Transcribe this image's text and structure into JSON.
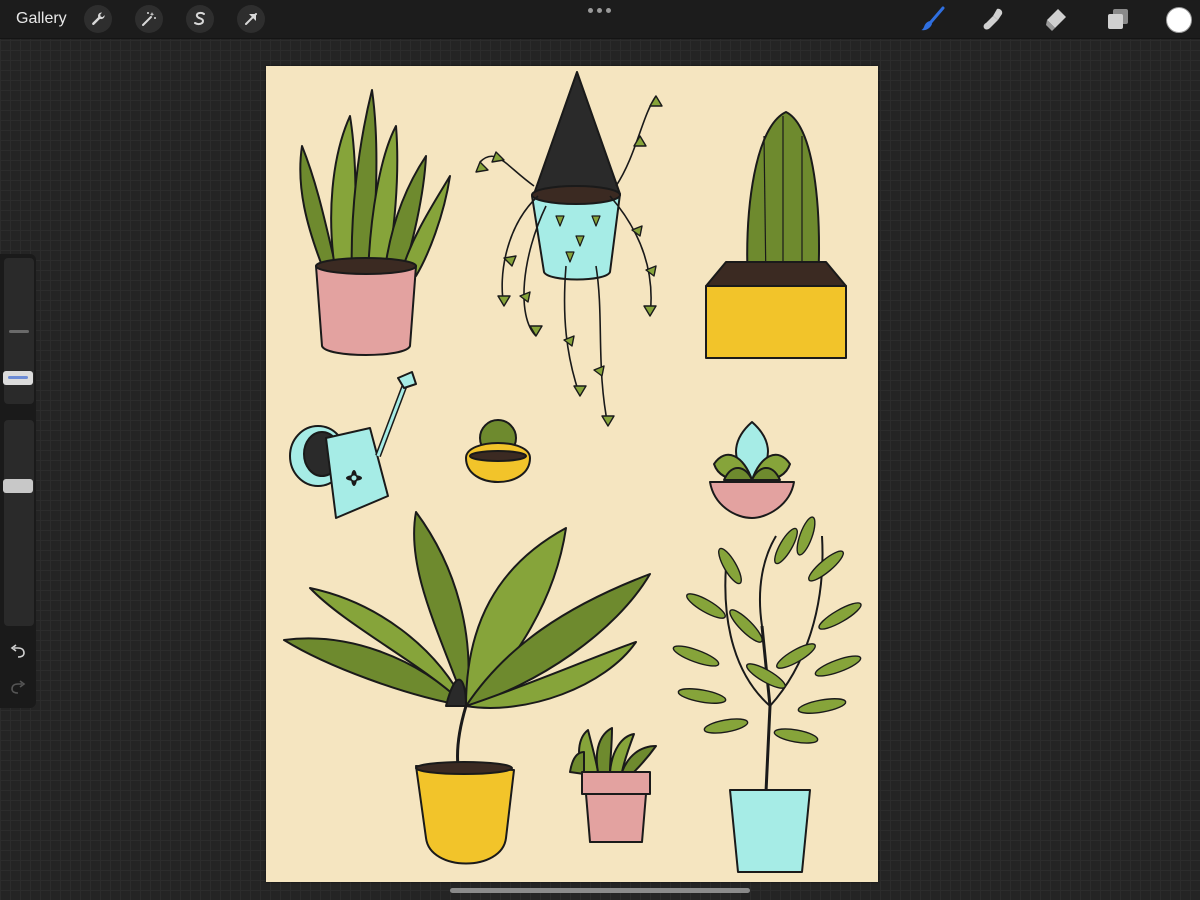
{
  "topbar": {
    "gallery_label": "Gallery",
    "tools_left": [
      "wrench-icon",
      "magic-wand-icon",
      "selection-s-icon",
      "transform-arrow-icon"
    ],
    "tools_right": [
      "brush-icon",
      "smudge-icon",
      "eraser-icon",
      "layers-icon"
    ],
    "active_tool": "brush",
    "active_color": "#ffffff",
    "brush_accent": "#2f6fe0"
  },
  "sidebar": {
    "controls": [
      "brush-size-slider",
      "opacity-slider",
      "modify-button",
      "undo-button",
      "redo-button"
    ],
    "slider_accent": "#6d8cd6"
  },
  "canvas": {
    "background": "#f5e5c0",
    "artwork": [
      "snake-plant",
      "hanging-pothos",
      "tall-cactus",
      "watering-can",
      "small-cactus",
      "succulent",
      "large-leafy-plant",
      "small-succulent-pot",
      "olive-tree"
    ],
    "palette": {
      "leaf_green": "#6e8a2e",
      "leaf_light": "#86a43a",
      "pink": "#e3a2a0",
      "teal": "#a6ece6",
      "yellow": "#f2c42a",
      "soil": "#3b2a22",
      "outline": "#1a1a1a"
    }
  }
}
